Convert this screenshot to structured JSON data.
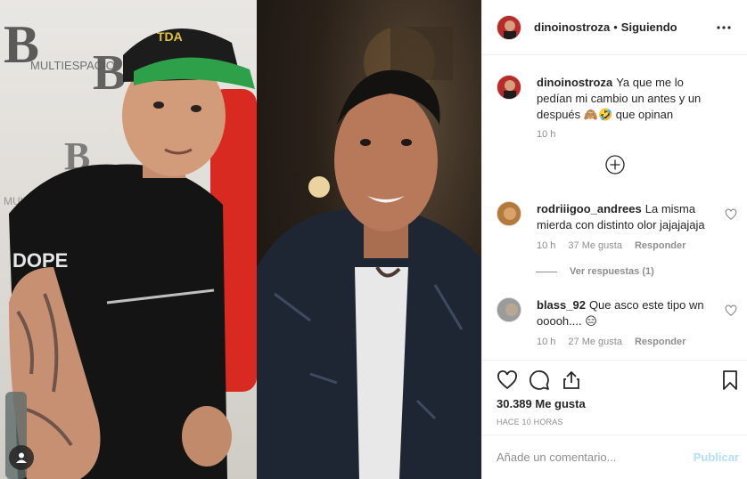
{
  "post": {
    "author": "dinoinostroza",
    "separator": "•",
    "follow_status": "Siguiendo",
    "caption": {
      "username": "dinoinostroza",
      "text": "Ya que me lo pedían mi cambio un antes y un después 🙈🤣 que opinan",
      "time": "10 h"
    },
    "comments": [
      {
        "username": "rodriiigoo_andrees",
        "text": "La misma mierda con distinto olor jajajajaja",
        "time": "10 h",
        "likes": "37 Me gusta",
        "reply_label": "Responder",
        "view_replies": "Ver respuestas (1)"
      },
      {
        "username": "blass_92",
        "text": "Que asco este tipo wn ooooh.... 😑",
        "time": "10 h",
        "likes": "27 Me gusta",
        "reply_label": "Responder"
      }
    ],
    "likes_count": "30.389 Me gusta",
    "time_ago": "HACE 10 HORAS",
    "add_comment_placeholder": "Añade un comentario...",
    "publish_label": "Publicar"
  },
  "icons": {
    "more": "more-options-icon",
    "load_more": "plus-circle-icon",
    "like": "heart-icon",
    "comment": "comment-bubble-icon",
    "share": "share-icon",
    "save": "bookmark-icon",
    "person_tag": "person-tag-icon"
  },
  "colors": {
    "publish_disabled": "#b2dffc",
    "meta_gray": "#8e8e8e",
    "divider": "#efefef",
    "text": "#262626"
  }
}
